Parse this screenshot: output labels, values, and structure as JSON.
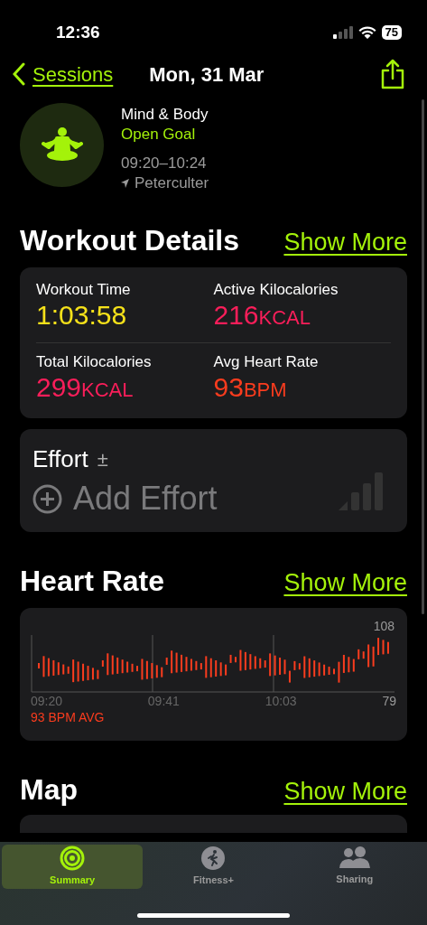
{
  "status_bar": {
    "time": "12:36",
    "battery": "75"
  },
  "nav": {
    "back": "Sessions",
    "title": "Mon, 31 Mar"
  },
  "workout": {
    "type": "Mind & Body",
    "goal": "Open Goal",
    "time_range": "09:20–10:24",
    "location": "Peterculter"
  },
  "details": {
    "title": "Workout Details",
    "show_more": "Show More",
    "metrics": [
      {
        "label": "Workout Time",
        "value": "1:03:58",
        "color": "#f5e11a"
      },
      {
        "label": "Active Kilocalories",
        "value": "216",
        "unit": "KCAL",
        "color": "#fa1e5a"
      },
      {
        "label": "Total Kilocalories",
        "value": "299",
        "unit": "KCAL",
        "color": "#fa1e5a"
      },
      {
        "label": "Avg Heart Rate",
        "value": "93",
        "unit": "BPM",
        "color": "#fa3c1e"
      }
    ]
  },
  "effort": {
    "title": "Effort",
    "symbol": "±",
    "action": "Add Effort"
  },
  "heart_rate": {
    "title": "Heart Rate",
    "show_more": "Show More",
    "max": "108",
    "min": "79",
    "times": [
      "09:20",
      "09:41",
      "10:03"
    ],
    "average": "93 BPM AVG"
  },
  "map": {
    "title": "Map",
    "show_more": "Show More"
  },
  "tabs": [
    {
      "label": "Summary",
      "selected": true
    },
    {
      "label": "Fitness+",
      "selected": false
    },
    {
      "label": "Sharing",
      "selected": false
    }
  ]
}
